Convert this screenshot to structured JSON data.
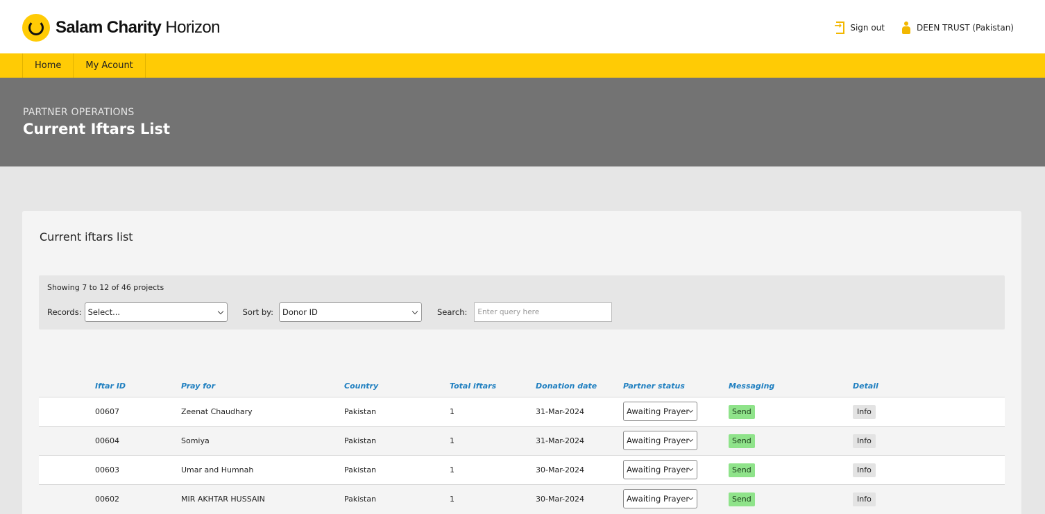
{
  "brand": {
    "name_bold": "Salam Charity",
    "name_light": "Horizon"
  },
  "header": {
    "signout_label": "Sign out",
    "org_label": "DEEN TRUST (Pakistan)"
  },
  "nav": {
    "items": [
      {
        "label": "Home"
      },
      {
        "label": "My Acount"
      }
    ]
  },
  "banner": {
    "kicker": "PARTNER OPERATIONS",
    "title": "Current Iftars List"
  },
  "card": {
    "title": "Current iftars list"
  },
  "filters": {
    "showing": "Showing 7 to 12 of 46 projects",
    "records_label": "Records:",
    "records_value": "Select...",
    "sort_label": "Sort by:",
    "sort_value": "Donor ID",
    "search_label": "Search:",
    "search_placeholder": "Enter query here"
  },
  "table": {
    "headers": {
      "iftar_id": "Iftar ID",
      "pray_for": "Pray for",
      "country": "Country",
      "total_iftars": "Total iftars",
      "donation_date": "Donation date",
      "partner_status": "Partner status",
      "messaging": "Messaging",
      "detail": "Detail"
    },
    "rows": [
      {
        "id": "00607",
        "pray_for": "Zeenat Chaudhary",
        "country": "Pakistan",
        "total": "1",
        "date": "31-Mar-2024",
        "status": "Awaiting Prayer",
        "send": "Send",
        "info": "Info"
      },
      {
        "id": "00604",
        "pray_for": "Somiya",
        "country": "Pakistan",
        "total": "1",
        "date": "31-Mar-2024",
        "status": "Awaiting Prayer",
        "send": "Send",
        "info": "Info"
      },
      {
        "id": "00603",
        "pray_for": "Umar and Humnah",
        "country": "Pakistan",
        "total": "1",
        "date": "30-Mar-2024",
        "status": "Awaiting Prayer",
        "send": "Send",
        "info": "Info"
      },
      {
        "id": "00602",
        "pray_for": "MIR AKHTAR HUSSAIN",
        "country": "Pakistan",
        "total": "1",
        "date": "30-Mar-2024",
        "status": "Awaiting Prayer",
        "send": "Send",
        "info": "Info"
      }
    ]
  },
  "colors": {
    "brand_yellow": "#ffcb05",
    "banner_gray": "#737373",
    "header_blue": "#1f7fc0",
    "send_green": "#8fe38a"
  }
}
